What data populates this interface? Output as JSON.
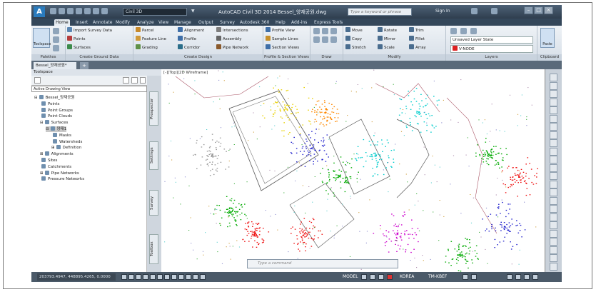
{
  "titlebar": {
    "workspace": "Civil 3D",
    "app_title": "AutoCAD Civil 3D 2014   Bessel_양재공원.dwg",
    "search_placeholder": "Type a keyword or phrase",
    "sign_in": "Sign In"
  },
  "ribbon_tabs": [
    "Home",
    "Insert",
    "Annotate",
    "Modify",
    "Analyze",
    "View",
    "Manage",
    "Output",
    "Survey",
    "Autodesk 360",
    "Help",
    "Add-ins",
    "Express Tools"
  ],
  "ribbon": {
    "toolspace_label": "Toolspace",
    "ground": {
      "import": "Import Survey Data",
      "points": "Points",
      "surfaces": "Surfaces",
      "title": "Create Ground Data"
    },
    "design1": {
      "parcel": "Parcel",
      "feature": "Feature Line",
      "grading": "Grading"
    },
    "design2": {
      "alignment": "Alignment",
      "profile": "Profile",
      "corridor": "Corridor"
    },
    "design3": {
      "intersections": "Intersections",
      "assembly": "Assembly",
      "pipe": "Pipe Network"
    },
    "design_title": "Create Design",
    "prof": {
      "pview": "Profile View",
      "sample": "Sample Lines",
      "section": "Section Views",
      "title": "Profile & Section Views"
    },
    "draw_title": "Draw",
    "modify": {
      "move": "Move",
      "copy": "Copy",
      "stretch": "Stretch",
      "rotate": "Rotate",
      "mirror": "Mirror",
      "scale": "Scale",
      "trim": "Trim",
      "fillet": "Fillet",
      "array": "Array",
      "title": "Modify"
    },
    "layers": {
      "state": "Unsaved Layer State",
      "layer": "V-NODE",
      "title": "Layers"
    },
    "clipboard": {
      "paste": "Paste",
      "title": "Clipboard"
    },
    "palettes_title": "Palettes"
  },
  "doc_tab": "Bessel_양재공원*",
  "toolspace": {
    "header": "Toolspace",
    "view_dropdown": "Active Drawing View",
    "tree": [
      {
        "label": "Bessel_양재공원",
        "level": 0,
        "prefix": "⊟"
      },
      {
        "label": "Points",
        "level": 1,
        "prefix": ""
      },
      {
        "label": "Point Groups",
        "level": 1,
        "prefix": ""
      },
      {
        "label": "Point Clouds",
        "level": 1,
        "prefix": ""
      },
      {
        "label": "Surfaces",
        "level": 1,
        "prefix": "⊟"
      },
      {
        "label": "양재1",
        "level": 2,
        "prefix": "⊟"
      },
      {
        "label": "Masks",
        "level": 3,
        "prefix": ""
      },
      {
        "label": "Watersheds",
        "level": 3,
        "prefix": ""
      },
      {
        "label": "Definition",
        "level": 3,
        "prefix": "⊞"
      },
      {
        "label": "Alignments",
        "level": 1,
        "prefix": "⊞"
      },
      {
        "label": "Sites",
        "level": 1,
        "prefix": ""
      },
      {
        "label": "Catchments",
        "level": 1,
        "prefix": ""
      },
      {
        "label": "Pipe Networks",
        "level": 1,
        "prefix": "⊞"
      },
      {
        "label": "Pressure Networks",
        "level": 1,
        "prefix": ""
      }
    ],
    "vtabs": [
      "Prospector",
      "Settings",
      "Survey",
      "Toolbox"
    ]
  },
  "viewport_label": "[-][Top][2D Wireframe]",
  "command_placeholder": "Type a command",
  "status": {
    "coords": "203793.4947, 448895.4265, 0.0000",
    "model": "MODEL",
    "korea": "KOREA",
    "layer": "TM-KBEF"
  }
}
